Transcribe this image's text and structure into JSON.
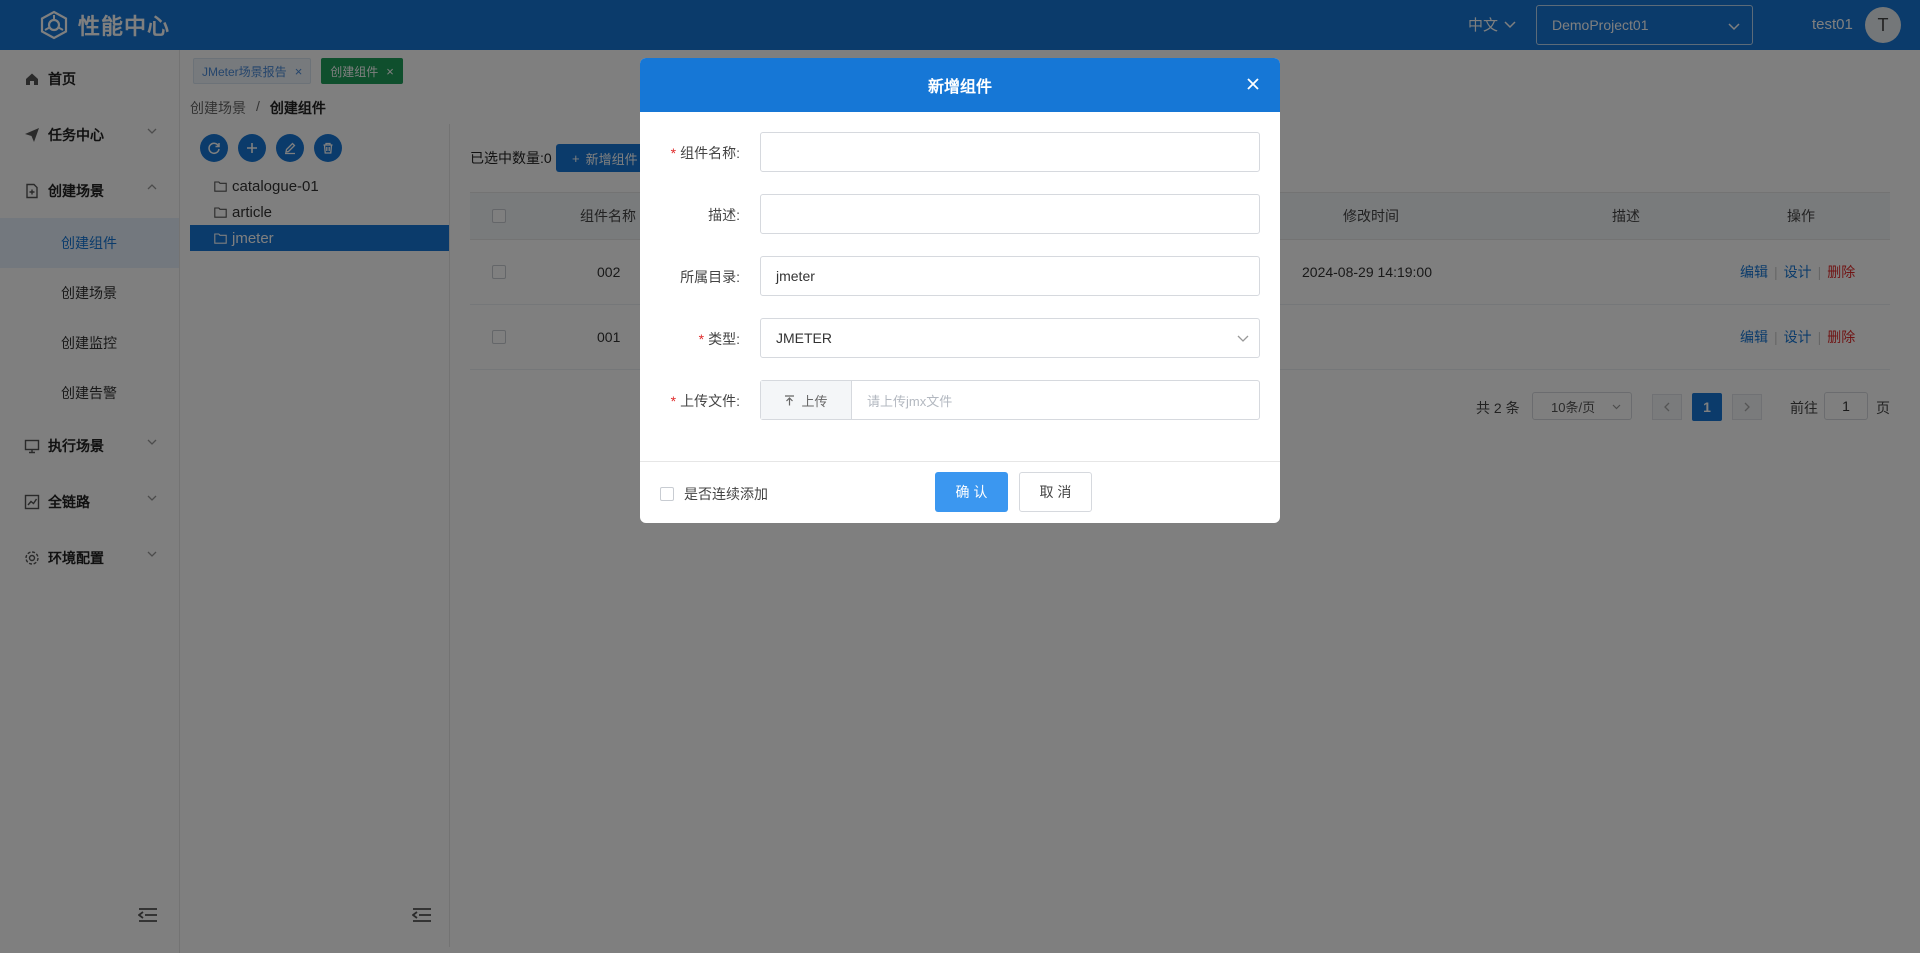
{
  "header": {
    "title": "性能中心",
    "language": "中文",
    "project": "DemoProject01",
    "user": "test01",
    "avatar_letter": "T"
  },
  "sidebar": {
    "items": [
      {
        "label": "首页",
        "icon": "home-icon"
      },
      {
        "label": "任务中心",
        "icon": "send-icon"
      },
      {
        "label": "创建场景",
        "icon": "file-add-icon"
      },
      {
        "label": "执行场景",
        "icon": "monitor-icon"
      },
      {
        "label": "全链路",
        "icon": "chart-icon"
      },
      {
        "label": "环境配置",
        "icon": "gear-icon"
      }
    ],
    "subitems": [
      {
        "label": "创建组件",
        "active": true
      },
      {
        "label": "创建场景"
      },
      {
        "label": "创建监控"
      },
      {
        "label": "创建告警"
      }
    ]
  },
  "tabs": [
    {
      "label": "JMeter场景报告",
      "active": false
    },
    {
      "label": "创建组件",
      "active": true
    }
  ],
  "breadcrumb": {
    "parent": "创建场景",
    "separator": "/",
    "current": "创建组件"
  },
  "tree": {
    "nodes": [
      {
        "label": "catalogue-01"
      },
      {
        "label": "article"
      },
      {
        "label": "jmeter",
        "selected": true
      }
    ]
  },
  "main": {
    "selected_count_label": "已选中数量:0",
    "add_button": "新增组件",
    "table": {
      "columns": [
        "组件名称",
        "修改时间",
        "描述",
        "操作"
      ],
      "rows": [
        {
          "name": "002",
          "modified": "2024-08-29 14:19:00",
          "desc": ""
        },
        {
          "name": "001",
          "modified": "",
          "desc": ""
        }
      ],
      "actions": [
        "编辑",
        "设计",
        "删除"
      ]
    },
    "pagination": {
      "total": "共 2 条",
      "page_size": "10条/页",
      "current": "1",
      "goto_prefix": "前往",
      "goto_value": "1",
      "goto_suffix": "页"
    }
  },
  "modal": {
    "title": "新增组件",
    "fields": {
      "name": {
        "label": "组件名称:",
        "value": ""
      },
      "desc": {
        "label": "描述:",
        "value": ""
      },
      "dir": {
        "label": "所属目录:",
        "value": "jmeter"
      },
      "type": {
        "label": "类型:",
        "value": "JMETER"
      },
      "file": {
        "label": "上传文件:",
        "button": "上传",
        "placeholder": "请上传jmx文件"
      }
    },
    "continuous_add": "是否连续添加",
    "confirm": "确 认",
    "cancel": "取 消"
  },
  "colors": {
    "primary": "#1677d6",
    "tab_active": "#1e9e5a",
    "danger": "#e02a2a"
  }
}
